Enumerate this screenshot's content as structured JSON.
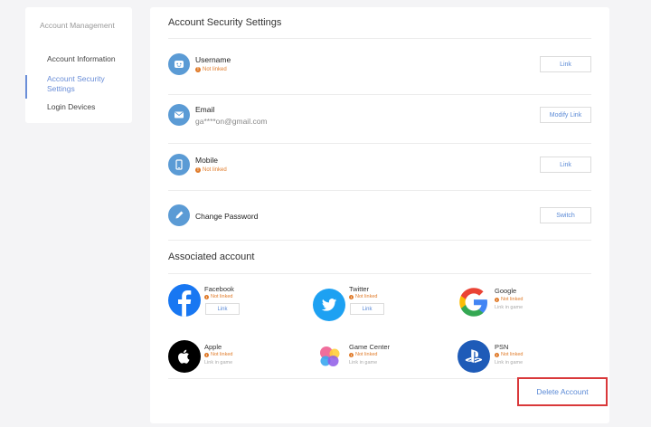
{
  "sidebar": {
    "header": "Account Management",
    "items": [
      {
        "label": "Account Information",
        "active": false
      },
      {
        "label": "Account Security Settings",
        "active": true
      },
      {
        "label": "Login Devices",
        "active": false
      }
    ]
  },
  "security": {
    "title": "Account Security Settings",
    "rows": [
      {
        "label": "Username",
        "status": "Not linked",
        "button": "Link"
      },
      {
        "label": "Email",
        "value": "ga****on@gmail.com",
        "button": "Modify Link"
      },
      {
        "label": "Mobile",
        "status": "Not linked",
        "button": "Link"
      },
      {
        "label": "Change Password",
        "button": "Switch"
      }
    ]
  },
  "associated": {
    "title": "Associated account",
    "accounts": [
      {
        "name": "Facebook",
        "status": "Not linked",
        "button": "Link"
      },
      {
        "name": "Twitter",
        "status": "Not linked",
        "button": "Link"
      },
      {
        "name": "Google",
        "status": "Not linked",
        "sub": "Link in game"
      },
      {
        "name": "Apple",
        "status": "Not linked",
        "sub": "Link in game"
      },
      {
        "name": "Game Center",
        "status": "Not linked",
        "sub": "Link in game"
      },
      {
        "name": "PSN",
        "status": "Not linked",
        "sub": "Link in game"
      }
    ]
  },
  "delete_account": "Delete Account",
  "colors": {
    "accent": "#5b8ad6",
    "warning": "#e07b2a",
    "highlight": "#d9383a"
  }
}
